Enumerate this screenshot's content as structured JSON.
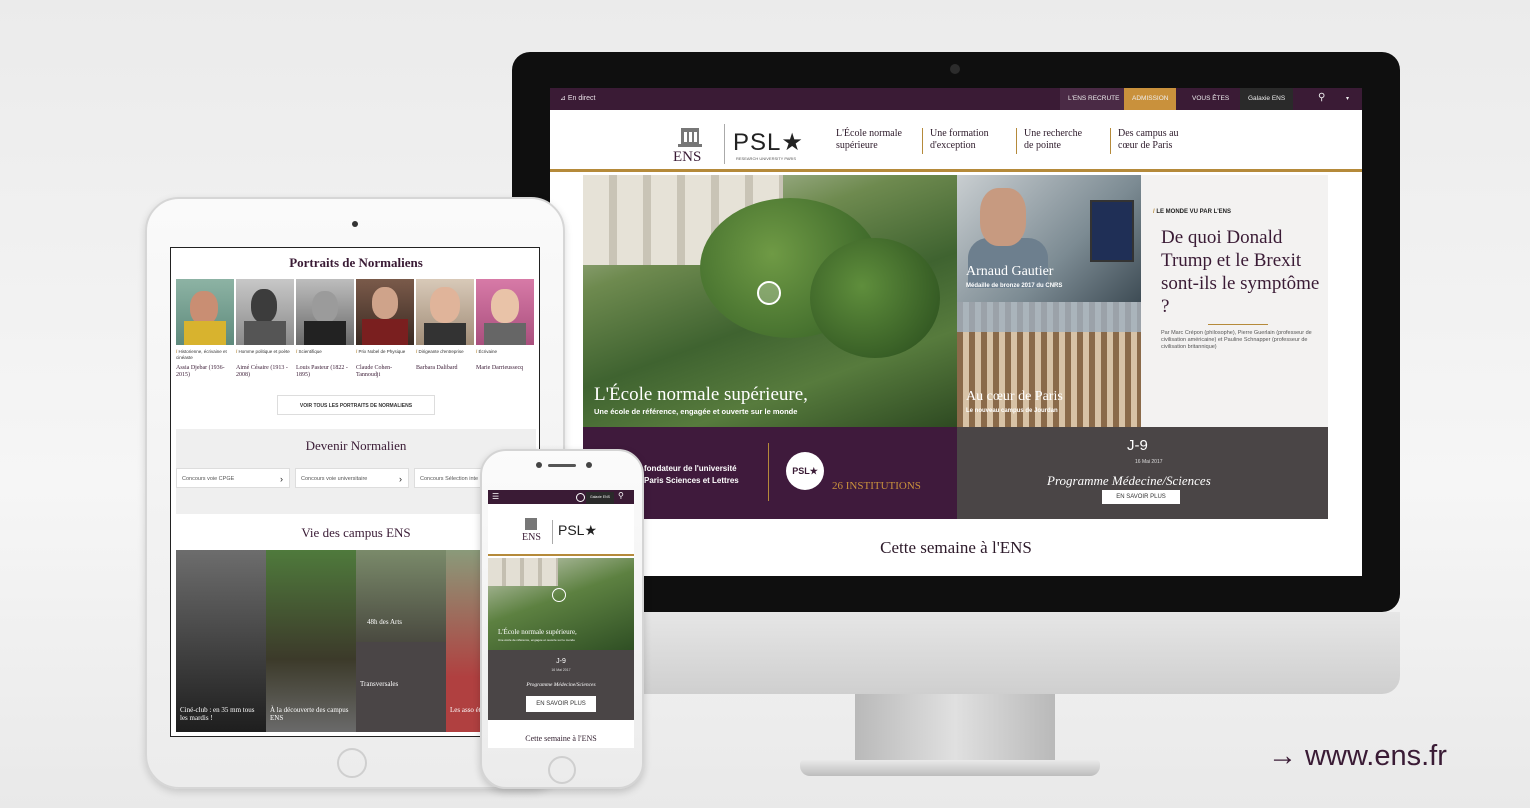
{
  "desktop": {
    "topbar": {
      "live": "En direct",
      "recruits": "L'ENS RECRUTE",
      "admission": "ADMISSION",
      "you_are": "VOUS ÊTES",
      "galaxy": "Galaxie ENS",
      "search_icon": "search-icon",
      "accent": "#c9913c",
      "bg": "#3a1b35"
    },
    "header": {
      "ens_logo": "ENS",
      "psl_logo": "PSL★",
      "psl_sub": "RESEARCH UNIVERSITY PARIS",
      "nav": [
        {
          "line1": "L'École normale",
          "line2": "supérieure"
        },
        {
          "line1": "Une formation",
          "line2": "d'exception"
        },
        {
          "line1": "Une recherche",
          "line2": "de pointe"
        },
        {
          "line1": "Des campus au",
          "line2": "cœur de Paris"
        }
      ]
    },
    "hero": {
      "title": "L'École normale supérieure,",
      "subtitle": "Une école de référence, engagée et ouverte sur le monde"
    },
    "tiles": [
      {
        "title": "Arnaud Gautier",
        "subtitle": "Médaille de bronze 2017 du CNRS"
      },
      {
        "title": "Au cœur de Paris",
        "subtitle": "Le nouveau campus de Jourdan"
      }
    ],
    "article": {
      "kicker": "LE MONDE VU PAR L'ENS",
      "title": "De quoi Donald Trump et le Brexit sont-ils le symptôme ?",
      "byline": "Par Marc Crépon (philosophe), Pierre Guerlain (professeur de civilisation américaine) et Pauline Schnapper (professeur de civilisation britannique)"
    },
    "psl_band": {
      "text_line1": "fondateur de l'université",
      "text_line2": "Paris Sciences et Lettres",
      "badge": "PSL★",
      "institutions": "26 INSTITUTIONS"
    },
    "event_band": {
      "countdown": "J-9",
      "date": "16 Mai 2017",
      "program": "Programme Médecine/Sciences",
      "button": "EN SAVOIR PLUS"
    },
    "section_title": "Cette semaine à l'ENS"
  },
  "tablet": {
    "portraits_title": "Portraits de Normaliens",
    "portraits": [
      {
        "role": "Historienne, écrivaine et cinéaste",
        "name": "Assia Djebar (1936-2015)"
      },
      {
        "role": "Homme politique et poète",
        "name": "Aimé Césaire (1913 - 2008)"
      },
      {
        "role": "Scientifique",
        "name": "Louis Pasteur (1822 - 1895)"
      },
      {
        "role": "Prix Nobel de Physique",
        "name": "Claude Cohen-Tannoudji"
      },
      {
        "role": "Dirigeante d'entreprise",
        "name": "Barbara Dalibard"
      },
      {
        "role": "Écrivaine",
        "name": "Marie Darrieussecq"
      }
    ],
    "portraits_button": "VOIR TOUS LES PORTRAITS DE NORMALIENS",
    "become_title": "Devenir Normalien",
    "contests": [
      "Concours voie CPGE",
      "Concours voie universitaire",
      "Concours Sélection inte"
    ],
    "campus_title": "Vie des campus ENS",
    "campus_tiles": [
      {
        "caption": "Ciné-club : en 35 mm tous les mardis !"
      },
      {
        "caption": "À la découverte des campus ENS"
      },
      {
        "caption": "48h des Arts"
      },
      {
        "caption": "Transversales"
      },
      {
        "caption": "Les asso étudiant"
      }
    ]
  },
  "phone": {
    "galaxy": "Galaxie ENS",
    "ens_logo": "ENS",
    "psl_logo": "PSL★",
    "hero_title": "L'École normale supérieure,",
    "hero_sub": "Une école de référence, engagée et ouverte sur le monde",
    "countdown": "J-9",
    "date": "16 Mai 2017",
    "program": "Programme Médecine/Sciences",
    "button": "EN SAVOIR PLUS",
    "section_title": "Cette semaine à l'ENS"
  },
  "footer": {
    "url": "→ www.ens.fr"
  }
}
